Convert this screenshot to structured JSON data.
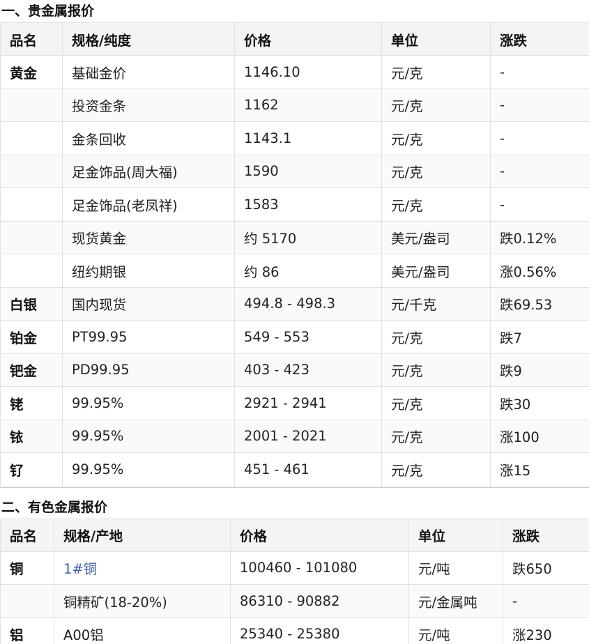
{
  "sections": [
    {
      "title": "一、贵金属报价",
      "headers": [
        "品名",
        "规格/纯度",
        "价格",
        "单位",
        "涨跌"
      ],
      "rows": [
        [
          "黄金",
          "基础金价",
          "1146.10",
          "元/克",
          "-"
        ],
        [
          "",
          "投资金条",
          "1162",
          "元/克",
          "-"
        ],
        [
          "",
          "金条回收",
          "1143.1",
          "元/克",
          "-"
        ],
        [
          "",
          "足金饰品(周大福)",
          "1590",
          "元/克",
          "-"
        ],
        [
          "",
          "足金饰品(老凤祥)",
          "1583",
          "元/克",
          "-"
        ],
        [
          "",
          "现货黄金",
          "约 5170",
          "美元/盎司",
          "跌0.12%"
        ],
        [
          "",
          "纽约期银",
          "约 86",
          "美元/盎司",
          "涨0.56%"
        ],
        [
          "白银",
          "国内现货",
          "494.8 - 498.3",
          "元/千克",
          "跌69.53"
        ],
        [
          "铂金",
          "PT99.95",
          "549 - 553",
          "元/克",
          "跌7"
        ],
        [
          "钯金",
          "PD99.95",
          "403 - 423",
          "元/克",
          "跌9"
        ],
        [
          "铑",
          "99.95%",
          "2921 - 2941",
          "元/克",
          "跌30"
        ],
        [
          "铱",
          "99.95%",
          "2001 - 2021",
          "元/克",
          "涨100"
        ],
        [
          "钌",
          "99.95%",
          "451 - 461",
          "元/克",
          "涨15"
        ]
      ]
    },
    {
      "title": "二、有色金属报价",
      "headers": [
        "品名",
        "规格/产地",
        "价格",
        "单位",
        "涨跌"
      ],
      "rows": [
        [
          "铜",
          "1#铜",
          "100460 - 101080",
          "元/吨",
          "跌650"
        ],
        [
          "",
          "铜精矿(18-20%)",
          "86310 - 90882",
          "元/金属吨",
          "-"
        ],
        [
          "铝",
          "A00铝",
          "25340 - 25380",
          "元/吨",
          "涨230"
        ]
      ]
    }
  ]
}
